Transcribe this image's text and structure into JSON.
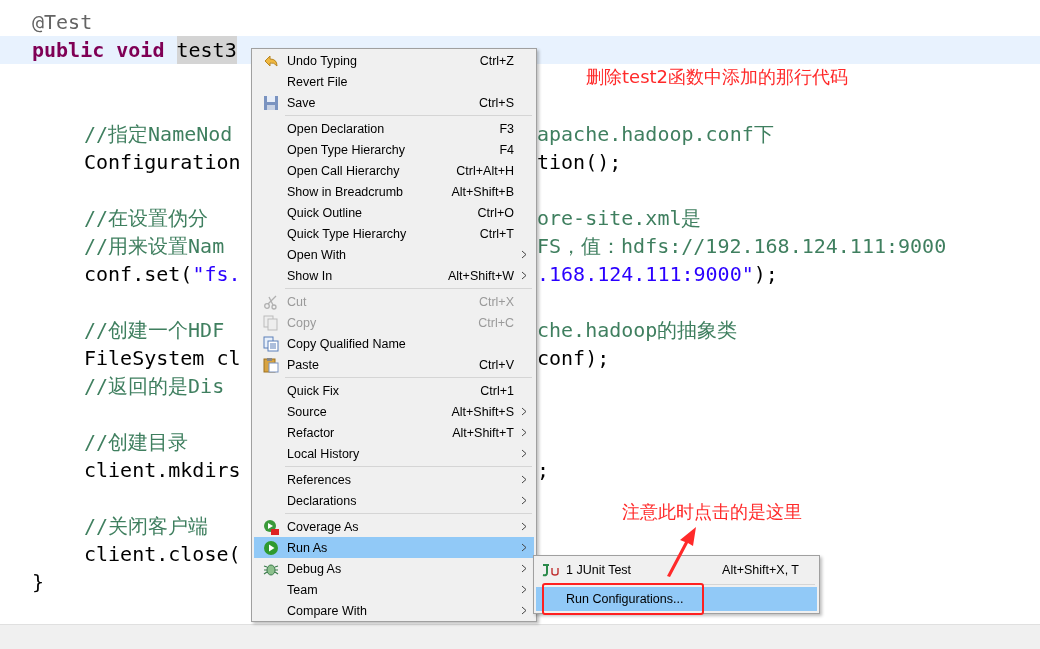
{
  "code_lines": [
    {
      "kind": "top",
      "left": [
        {
          "kind": "annotation",
          "text": "@Test"
        }
      ]
    },
    {
      "kind": "current",
      "left": [
        {
          "kind": "keyword",
          "text": "public void "
        },
        {
          "kind": "occurrence",
          "text": "test3"
        }
      ]
    },
    {
      "kind": "blank"
    },
    {
      "kind": "blank"
    },
    {
      "kind": "body",
      "left": [
        {
          "kind": "comment",
          "text": "//指定NameNod"
        }
      ],
      "right": [
        {
          "kind": "comment",
          "text": "apache.hadoop.conf下"
        }
      ]
    },
    {
      "kind": "body",
      "left": [
        {
          "kind": "plain",
          "text": "Configuration"
        }
      ],
      "right": [
        {
          "kind": "plain",
          "text": "tion();"
        }
      ]
    },
    {
      "kind": "blank"
    },
    {
      "kind": "body",
      "left": [
        {
          "kind": "comment",
          "text": "//在设置伪分"
        }
      ],
      "right": [
        {
          "kind": "comment",
          "text": "ore-site.xml是"
        }
      ]
    },
    {
      "kind": "body",
      "left": [
        {
          "kind": "comment",
          "text": "//用来设置Nam"
        }
      ],
      "right": [
        {
          "kind": "comment",
          "text": "FS，值：hdfs://192.168.124.111:9000"
        }
      ]
    },
    {
      "kind": "body",
      "left": [
        {
          "kind": "plain",
          "text": "conf.set("
        },
        {
          "kind": "string",
          "text": "\"fs."
        }
      ],
      "right": [
        {
          "kind": "string",
          "text": ".168.124.111:9000\""
        },
        {
          "kind": "plain",
          "text": ");"
        }
      ]
    },
    {
      "kind": "blank"
    },
    {
      "kind": "body",
      "left": [
        {
          "kind": "comment",
          "text": "//创建一个HDF"
        }
      ],
      "right": [
        {
          "kind": "comment",
          "text": "che.hadoop的抽象类"
        }
      ]
    },
    {
      "kind": "body",
      "left": [
        {
          "kind": "plain",
          "text": "FileSystem cl"
        }
      ],
      "right": [
        {
          "kind": "plain",
          "text": "conf);"
        }
      ]
    },
    {
      "kind": "body",
      "left": [
        {
          "kind": "comment",
          "text": "//返回的是Dis"
        }
      ]
    },
    {
      "kind": "blank"
    },
    {
      "kind": "body",
      "left": [
        {
          "kind": "comment",
          "text": "//创建目录"
        }
      ]
    },
    {
      "kind": "body",
      "left": [
        {
          "kind": "plain",
          "text": "client.mkdirs"
        }
      ],
      "right": [
        {
          "kind": "plain",
          "text": ";"
        }
      ]
    },
    {
      "kind": "blank"
    },
    {
      "kind": "body",
      "left": [
        {
          "kind": "comment",
          "text": "//关闭客户端"
        }
      ]
    },
    {
      "kind": "body",
      "left": [
        {
          "kind": "plain",
          "text": "client.close("
        }
      ]
    },
    {
      "kind": "top",
      "left": [
        {
          "kind": "plain",
          "text": "}"
        }
      ]
    }
  ],
  "context_menu": [
    {
      "kind": "item",
      "label": "Undo Typing",
      "shortcut": "Ctrl+Z",
      "submenu": false,
      "disabled": false,
      "selected": false
    },
    {
      "kind": "item",
      "label": "Revert File",
      "submenu": false,
      "disabled": false,
      "selected": false
    },
    {
      "kind": "item",
      "label": "Save",
      "shortcut": "Ctrl+S",
      "submenu": false,
      "disabled": false,
      "selected": false
    },
    {
      "kind": "separator"
    },
    {
      "kind": "item",
      "label": "Open Declaration",
      "shortcut": "F3",
      "submenu": false,
      "disabled": false,
      "selected": false
    },
    {
      "kind": "item",
      "label": "Open Type Hierarchy",
      "shortcut": "F4",
      "submenu": false,
      "disabled": false,
      "selected": false
    },
    {
      "kind": "item",
      "label": "Open Call Hierarchy",
      "shortcut": "Ctrl+Alt+H",
      "submenu": false,
      "disabled": false,
      "selected": false
    },
    {
      "kind": "item",
      "label": "Show in Breadcrumb",
      "shortcut": "Alt+Shift+B",
      "submenu": false,
      "disabled": false,
      "selected": false
    },
    {
      "kind": "item",
      "label": "Quick Outline",
      "shortcut": "Ctrl+O",
      "submenu": false,
      "disabled": false,
      "selected": false
    },
    {
      "kind": "item",
      "label": "Quick Type Hierarchy",
      "shortcut": "Ctrl+T",
      "submenu": false,
      "disabled": false,
      "selected": false
    },
    {
      "kind": "item",
      "label": "Open With",
      "submenu": true,
      "disabled": false,
      "selected": false
    },
    {
      "kind": "item",
      "label": "Show In",
      "shortcut": "Alt+Shift+W",
      "submenu": true,
      "disabled": false,
      "selected": false
    },
    {
      "kind": "separator"
    },
    {
      "kind": "item",
      "label": "Cut",
      "shortcut": "Ctrl+X",
      "submenu": false,
      "disabled": true,
      "selected": false
    },
    {
      "kind": "item",
      "label": "Copy",
      "shortcut": "Ctrl+C",
      "submenu": false,
      "disabled": true,
      "selected": false
    },
    {
      "kind": "item",
      "label": "Copy Qualified Name",
      "submenu": false,
      "disabled": false,
      "selected": false
    },
    {
      "kind": "item",
      "label": "Paste",
      "shortcut": "Ctrl+V",
      "submenu": false,
      "disabled": false,
      "selected": false
    },
    {
      "kind": "separator"
    },
    {
      "kind": "item",
      "label": "Quick Fix",
      "shortcut": "Ctrl+1",
      "submenu": false,
      "disabled": false,
      "selected": false
    },
    {
      "kind": "item",
      "label": "Source",
      "shortcut": "Alt+Shift+S",
      "submenu": true,
      "disabled": false,
      "selected": false
    },
    {
      "kind": "item",
      "label": "Refactor",
      "shortcut": "Alt+Shift+T",
      "submenu": true,
      "disabled": false,
      "selected": false
    },
    {
      "kind": "item",
      "label": "Local History",
      "submenu": true,
      "disabled": false,
      "selected": false
    },
    {
      "kind": "separator"
    },
    {
      "kind": "item",
      "label": "References",
      "submenu": true,
      "disabled": false,
      "selected": false
    },
    {
      "kind": "item",
      "label": "Declarations",
      "submenu": true,
      "disabled": false,
      "selected": false
    },
    {
      "kind": "separator"
    },
    {
      "kind": "item",
      "label": "Coverage As",
      "submenu": true,
      "disabled": false,
      "selected": false
    },
    {
      "kind": "item",
      "label": "Run As",
      "submenu": true,
      "disabled": false,
      "selected": true
    },
    {
      "kind": "item",
      "label": "Debug As",
      "submenu": true,
      "disabled": false,
      "selected": false
    },
    {
      "kind": "item",
      "label": "Team",
      "submenu": true,
      "disabled": false,
      "selected": false
    },
    {
      "kind": "item",
      "label": "Compare With",
      "submenu": true,
      "disabled": false,
      "selected": false
    }
  ],
  "submenu": [
    {
      "kind": "item",
      "label": "1 JUnit Test",
      "shortcut": "Alt+Shift+X, T",
      "selected": false
    },
    {
      "kind": "separator"
    },
    {
      "kind": "item",
      "label": "Run Configurations...",
      "selected": true
    }
  ],
  "annotations": [
    {
      "text": "删除test2函数中添加的那行代码"
    },
    {
      "text": "注意此时点击的是这里"
    }
  ]
}
